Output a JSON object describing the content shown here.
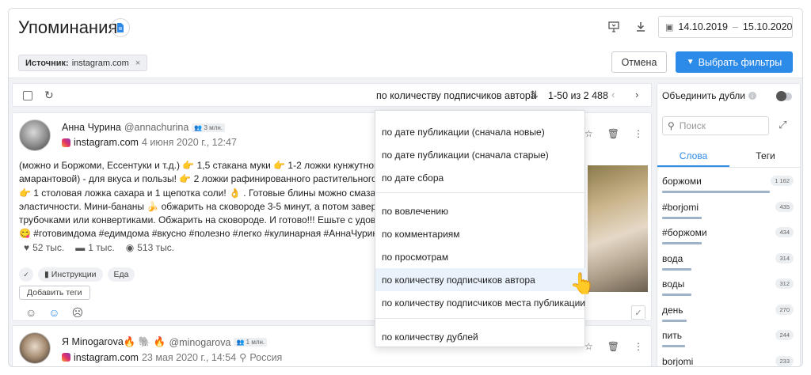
{
  "header": {
    "title": "Упоминания",
    "date_from": "14.10.2019",
    "date_sep": "–",
    "date_to": "15.10.2020"
  },
  "filters": {
    "source_label": "Источник:",
    "source_value": "instagram.com",
    "cancel_label": "Отмена",
    "apply_label": "Выбрать фильтры"
  },
  "toolbar": {
    "sort_label": "по количеству подписчиков автора",
    "range_label": "1-50 из 2 488"
  },
  "posts": [
    {
      "author_name": "Анна Чурина",
      "author_handle": "@annachurina",
      "subs_badge": "3 млн.",
      "source": "instagram.com",
      "date": "4 июня 2020 г., 12:47",
      "text_lines": [
        "(можно и Боржоми, Ессентуки и т.д.) 👉  1,5 стакана муки 👉  1-2 ложки кунжутной",
        "амарантовой) - для вкуса и пользы! 👉  2 ложки рафинированного растительного ма",
        "👉  1 столовая ложка сахара и 1 щепотка соли! 👌 . Готовые блины можно смазать",
        "эластичности. Мини-бананы 🍌  обжарить на сковороде 3-5 минут, а потом заверну",
        "трубочками или конвертиками. Обжарить на сковороде. И готово!!! Ешьте с удовол",
        "😋  #готовимдома #едимдома #вкусно #полезно #легко #кулинарная #АннаЧурина"
      ],
      "likes": "52 тыс.",
      "comments": "1 тыс.",
      "views": "513 тыс.",
      "tag_instructions": "Инструкции",
      "tag_food": "Еда",
      "add_tags": "Добавить теги"
    },
    {
      "author_name": "Я Minogarova🔥 🐘 🔥",
      "author_handle": "@minogarova",
      "subs_badge": "1 млн.",
      "source": "instagram.com",
      "date": "23 мая 2020 г., 14:54",
      "location": "Россия"
    }
  ],
  "sidebar": {
    "merge_label": "Объединить дубли",
    "search_placeholder": "Поиск",
    "tab_words": "Слова",
    "tab_tags": "Теги",
    "words": [
      {
        "word": "боржоми",
        "count": "1 162",
        "share": 1.0
      },
      {
        "word": "#borjomi",
        "count": "435",
        "share": 0.37
      },
      {
        "word": "#боржоми",
        "count": "434",
        "share": 0.37
      },
      {
        "word": "вода",
        "count": "314",
        "share": 0.27
      },
      {
        "word": "воды",
        "count": "312",
        "share": 0.27
      },
      {
        "word": "день",
        "count": "270",
        "share": 0.23
      },
      {
        "word": "пить",
        "count": "244",
        "share": 0.21
      },
      {
        "word": "borjomi",
        "count": "233",
        "share": 0.2
      }
    ]
  },
  "sort_menu": {
    "items": [
      "по дате публикации (сначала новые)",
      "по дате публикации (сначала старые)",
      "по дате сбора",
      "по вовлечению",
      "по комментариям",
      "по просмотрам",
      "по количеству подписчиков автора",
      "по количеству подписчиков места публикации",
      "по количеству дублей"
    ],
    "selected_index": 6
  },
  "colors": {
    "accent": "#2c8ae8",
    "word_bar": "#9fb3c9"
  }
}
